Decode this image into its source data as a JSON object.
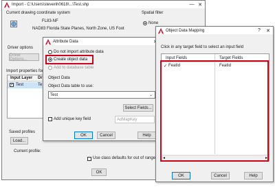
{
  "import_dialog": {
    "title": "Import - C:\\Users\\stevenh0618\\...\\Test.shp",
    "current_coord_label": "Current drawing coordinate system",
    "coord_code": "FL83-NF",
    "coord_desc": "NAD83 Florida State Planes, North Zone, US Foot",
    "spatial_filter_label": "Spatial filter",
    "spatial_none_label": "None",
    "driver_options_label": "Driver options",
    "driver_options_button": "Driver Options...",
    "import_props_label": "Import properties for ea",
    "table_headers": [
      "Input Layer",
      "Dr"
    ],
    "table_rows": [
      {
        "layer": "Test",
        "drawing": "Te"
      }
    ],
    "saved_profiles_label": "Saved profiles",
    "load_button": "Load...",
    "current_profile_label": "Current profile:",
    "class_defaults_label": "Use class defaults for out of range",
    "ok_button": "OK"
  },
  "attribute_dialog": {
    "title": "Attribute Data",
    "option_none": "Do not import attribute data",
    "option_create": "Create object data",
    "option_db": "Add to database table",
    "object_data_label": "Object Data",
    "table_to_use_label": "Object Data table to use:",
    "table_value": "Test",
    "select_fields_button": "Select Fields...",
    "unique_key_label": "Add unique key field",
    "key_field_value": "AdMapKey",
    "ok_button": "OK",
    "cancel_button": "Cancel",
    "help_button": "Help"
  },
  "mapping_dialog": {
    "title": "Object Data Mapping",
    "instruction": "Click in any target field to select an input field",
    "col_input": "Input Fields",
    "col_target": "Target Fields",
    "rows": [
      {
        "input": "FeatId",
        "target": "FeatId"
      }
    ],
    "ok_button": "OK",
    "cancel_button": "Cancel",
    "help_button": "Help"
  },
  "colors": {
    "highlight": "#d0021b",
    "autocad_red": "#c8102e",
    "focus_blue": "#0078d7"
  }
}
